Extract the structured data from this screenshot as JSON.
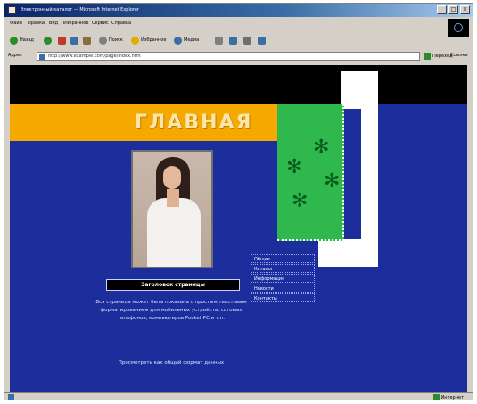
{
  "window": {
    "title": "Электронный каталог — Microsoft Internet Explorer",
    "controls": [
      "_",
      "□",
      "×"
    ]
  },
  "menu": [
    "Файл",
    "Правка",
    "Вид",
    "Избранное",
    "Сервис",
    "Справка"
  ],
  "toolbar": {
    "back": "Назад",
    "search": "Поиск",
    "favorites": "Избранное",
    "media": "Медиа"
  },
  "address": {
    "label": "Адрес",
    "url": "http://www.example.com/page/index.htm",
    "go": "Переход",
    "links": "Ссылки"
  },
  "page": {
    "title": "ГЛАВНАЯ",
    "nav": [
      "Общее",
      "Каталог",
      "Информация",
      "Новости",
      "Контакты"
    ],
    "heading": "Заголовок страницы",
    "paragraph1": "Вся страница может быть показана с простым текстовым форматированием для мобильных устройств, сотовых телефонов, компьютеров Pocket PC и т.п.",
    "paragraph2": "Просмотреть как общий формат данных"
  },
  "status": {
    "zone": "Интернет"
  },
  "colors": {
    "page_bg": "#1c2d9c",
    "orange": "#f5a800",
    "green": "#2eb84e",
    "title_fg": "#fbe6a8"
  }
}
